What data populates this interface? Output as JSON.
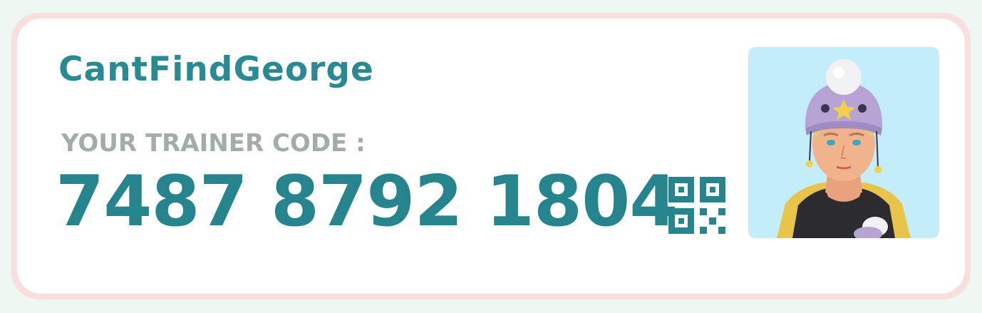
{
  "trainer": {
    "name": "CantFindGeorge",
    "code_label": "YOUR TRAINER CODE :",
    "code": "7487 8792 1804"
  },
  "icons": {
    "qr": "qr-code-icon",
    "avatar": "trainer-avatar"
  },
  "colors": {
    "accent": "#2a8a94",
    "label_gray": "#a3abab",
    "card_border": "#f9dede",
    "avatar_bg": "#c3edf8"
  }
}
